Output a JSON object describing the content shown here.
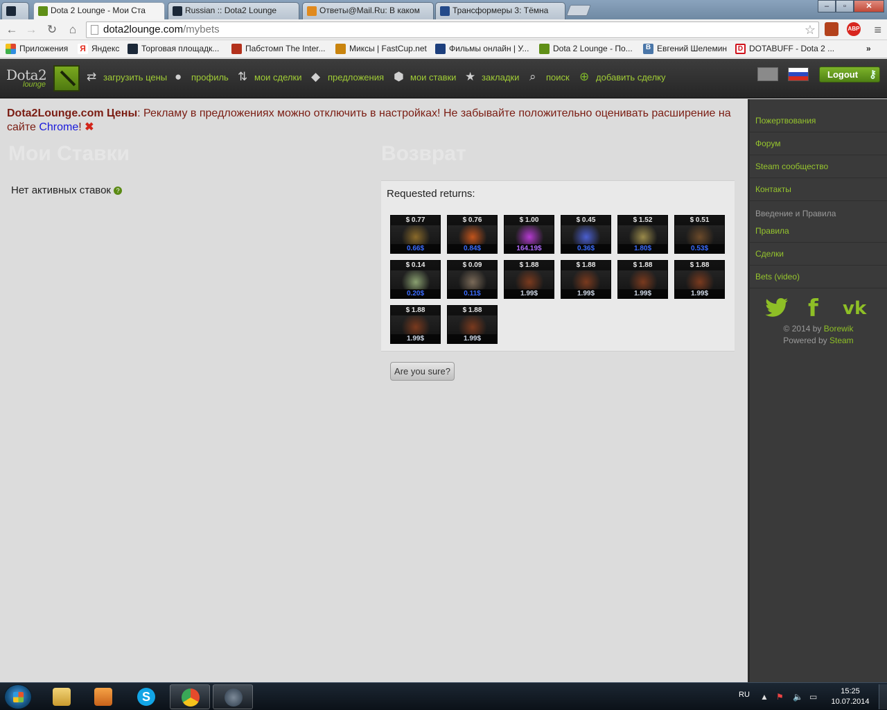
{
  "browser": {
    "tabs": [
      {
        "label": "",
        "favicon": "steam-icon",
        "color": "#1b2838"
      },
      {
        "label": "Dota 2 Lounge - Мои Ста",
        "favicon": "dota2lounge-icon",
        "color": "#5f8f17"
      },
      {
        "label": "Russian :: Dota2 Lounge",
        "favicon": "steam-icon",
        "color": "#1b2838"
      },
      {
        "label": "Ответы@Mail.Ru: В каком",
        "favicon": "mail-question-icon",
        "color": "#e08a1e"
      },
      {
        "label": "Трансформеры 3: Тёмна",
        "favicon": "film-icon",
        "color": "#244a8a"
      }
    ],
    "window_buttons": {
      "min": "–",
      "max": "▫",
      "close": "✕"
    },
    "url_host": "dota2lounge.com",
    "url_path": "/mybets",
    "extensions": [
      {
        "name": "dota-extension-icon",
        "color": "#b3421c"
      },
      {
        "name": "adblock-icon",
        "color": "#d8261f",
        "label": "ABP"
      }
    ],
    "bookmarks": [
      {
        "label": "Приложения",
        "icon": "apps-grid-icon",
        "color": "#e0442c"
      },
      {
        "label": "Яндекс",
        "icon": "yandex-icon",
        "color": "#e32a1d"
      },
      {
        "label": "Торговая площадк...",
        "icon": "steam-icon",
        "color": "#1b2838"
      },
      {
        "label": "Пабстомп The Inter...",
        "icon": "pubstomp-icon",
        "color": "#b3311c"
      },
      {
        "label": "Миксы | FastCup.net",
        "icon": "fastcup-icon",
        "color": "#c9840e"
      },
      {
        "label": "Фильмы онлайн | У...",
        "icon": "film-icon",
        "color": "#1d3f7d"
      },
      {
        "label": "Dota 2 Lounge - По...",
        "icon": "dota2lounge-icon",
        "color": "#5f8f17"
      },
      {
        "label": "Евгений Шелемин",
        "icon": "vk-icon",
        "color": "#4a76a8"
      },
      {
        "label": "DOTABUFF - Dota 2 ...",
        "icon": "dotabuff-icon",
        "color": "#d0121b"
      }
    ],
    "bookmarks_more": "»"
  },
  "site": {
    "logo_text": "Dota2",
    "logo_sub": "lounge",
    "nav": [
      {
        "label": "загрузить цены",
        "icon": "refresh-arrows-icon",
        "glyph": "⇄"
      },
      {
        "label": "профиль",
        "icon": "user-icon",
        "glyph": "●"
      },
      {
        "label": "мои сделки",
        "icon": "trade-arrows-icon",
        "glyph": "⇅"
      },
      {
        "label": "предложения",
        "icon": "tag-icon",
        "glyph": "◆"
      },
      {
        "label": "мои ставки",
        "icon": "dice-icon",
        "glyph": "⬢"
      },
      {
        "label": "закладки",
        "icon": "star-icon",
        "glyph": "★"
      },
      {
        "label": "поиск",
        "icon": "search-icon",
        "glyph": "⌕"
      },
      {
        "label": "добавить сделку",
        "icon": "add-circle-icon",
        "glyph": "⊕"
      }
    ],
    "logout_label": "Logout"
  },
  "notice": {
    "site_name": "Dota2Lounge.com Цены",
    "text": ": Рекламу в предложениях можно отключить в настройках! Не забывайте положительно оценивать расширение на сайте ",
    "link": "Chrome",
    "tail": "!",
    "close": "✖"
  },
  "mybets": {
    "title": "Мои Ставки",
    "empty_text": "Нет активных ставок ",
    "help": "?"
  },
  "returns": {
    "title": "Возврат",
    "requested_label": "Requested returns:",
    "confirm_label": "Are you sure?",
    "items": [
      {
        "price": "$ 0.77",
        "orig": "0.66$",
        "orig_color": "blue",
        "art": "#8a6a2a"
      },
      {
        "price": "$ 0.76",
        "orig": "0.84$",
        "orig_color": "blue",
        "art": "#c2541c"
      },
      {
        "price": "$ 1.00",
        "orig": "164.19$",
        "orig_color": "purple",
        "art": "#b43ad0"
      },
      {
        "price": "$ 0.45",
        "orig": "0.36$",
        "orig_color": "blue",
        "art": "#4b5fd0"
      },
      {
        "price": "$ 1.52",
        "orig": "1.80$",
        "orig_color": "blue",
        "art": "#9a8a4a"
      },
      {
        "price": "$ 0.51",
        "orig": "0.53$",
        "orig_color": "blue",
        "art": "#6b4a2a"
      },
      {
        "price": "$ 0.14",
        "orig": "0.20$",
        "orig_color": "blue",
        "art": "#8aa070"
      },
      {
        "price": "$ 0.09",
        "orig": "0.11$",
        "orig_color": "blue",
        "art": "#7a6a58"
      },
      {
        "price": "$ 1.88",
        "orig": "1.99$",
        "orig_color": "white",
        "art": "#7a3a1e"
      },
      {
        "price": "$ 1.88",
        "orig": "1.99$",
        "orig_color": "white",
        "art": "#7a3a1e"
      },
      {
        "price": "$ 1.88",
        "orig": "1.99$",
        "orig_color": "white",
        "art": "#7a3a1e"
      },
      {
        "price": "$ 1.88",
        "orig": "1.99$",
        "orig_color": "white",
        "art": "#7a3a1e"
      },
      {
        "price": "$ 1.88",
        "orig": "1.99$",
        "orig_color": "white",
        "art": "#7a3a1e"
      },
      {
        "price": "$ 1.88",
        "orig": "1.99$",
        "orig_color": "white",
        "art": "#7a3a1e"
      }
    ]
  },
  "sidebar": {
    "links_top": [
      "Пожертвования",
      "Форум",
      "Steam сообщество",
      "Контакты"
    ],
    "section_title": "Введение и Правила",
    "links_bottom": [
      "Правила",
      "Сделки",
      "Bets (video)"
    ],
    "socials": [
      {
        "name": "twitter-icon",
        "glyph": "🐦"
      },
      {
        "name": "facebook-icon",
        "glyph": "f"
      },
      {
        "name": "vk-icon",
        "glyph": "vk"
      }
    ],
    "copyright_prefix": "© 2014 by ",
    "copyright_author": "Borewik",
    "powered_prefix": "Powered by ",
    "powered_by": "Steam"
  },
  "taskbar": {
    "apps": [
      {
        "name": "explorer-icon",
        "color": "#e8c25a",
        "state": "pinned"
      },
      {
        "name": "media-player-icon",
        "color": "#e07a22",
        "state": "pinned"
      },
      {
        "name": "skype-icon",
        "color": "#12a5e6",
        "state": "pinned"
      },
      {
        "name": "chrome-icon",
        "color": "#e44b2c",
        "state": "open"
      },
      {
        "name": "steam-icon",
        "color": "#2b3a4a",
        "state": "open"
      }
    ],
    "language": "RU",
    "time": "15:25",
    "date": "10.07.2014"
  },
  "colors": {
    "accent_green": "#96c52d",
    "notice_red": "#7a1c12",
    "link_blue": "#1a1adb"
  }
}
